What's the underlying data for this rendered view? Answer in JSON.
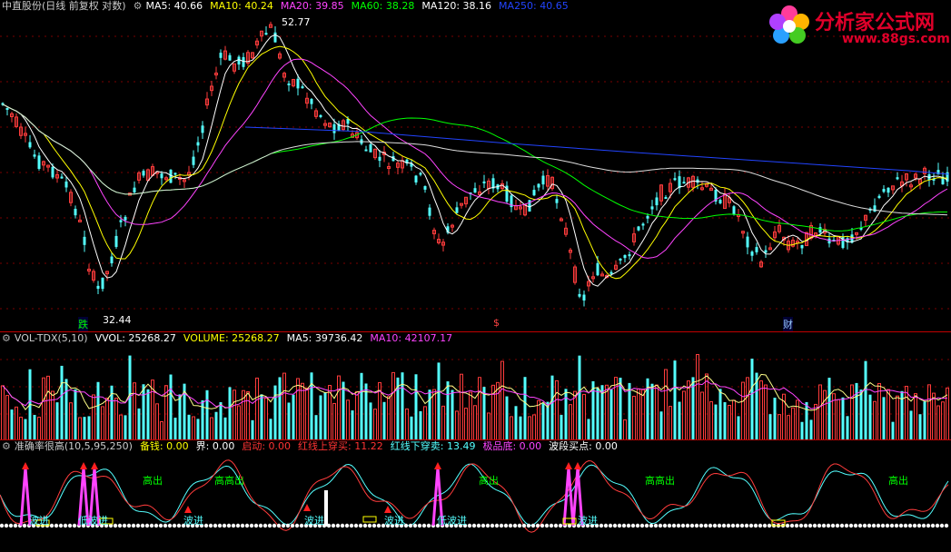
{
  "price": {
    "title": "中直股份(日线 前复权 对数)",
    "ma": [
      {
        "label": "MA5: 40.66",
        "color": "#ffffff"
      },
      {
        "label": "MA10: 40.24",
        "color": "#ffff00"
      },
      {
        "label": "MA20: 39.85",
        "color": "#ff44ff"
      },
      {
        "label": "MA60: 38.28",
        "color": "#00ff00"
      },
      {
        "label": "MA120: 38.16",
        "color": "#ffffff"
      },
      {
        "label": "MA250: 40.65",
        "color": "#2244ff"
      }
    ],
    "high_label": "52.77",
    "low_label": "32.44",
    "marker_1": "跌",
    "marker_2": "$",
    "marker_3": "财",
    "colors": {
      "up": "#ff3c3c",
      "down": "#54ffff",
      "ma5": "#ffffff",
      "ma10": "#ffff00",
      "ma20": "#ff44ff",
      "ma60": "#00ff00",
      "ma120": "#ffffff",
      "ma250": "#2244ff"
    }
  },
  "volume": {
    "title": "VOL-TDX(5,10)",
    "items": [
      {
        "label": "VVOL: 25268.27",
        "color": "#ffffff"
      },
      {
        "label": "VOLUME: 25268.27",
        "color": "#ffff00"
      },
      {
        "label": "MA5: 39736.42",
        "color": "#ffffff"
      },
      {
        "label": "MA10: 42107.17",
        "color": "#ff44ff"
      }
    ]
  },
  "indicator": {
    "title": "准确率很高(10,5,95,250)",
    "items": [
      {
        "label": "备钱: 0.00",
        "color": "#ffff00"
      },
      {
        "label": "界: 0.00",
        "color": "#ffffff"
      },
      {
        "label": "启动: 0.00",
        "color": "#ff3c3c"
      },
      {
        "label": "红线上穿买: 11.22",
        "color": "#ff3c3c"
      },
      {
        "label": "红线下穿卖: 13.49",
        "color": "#54ffff"
      },
      {
        "label": "极品底: 0.00",
        "color": "#ff44ff"
      },
      {
        "label": "波段买点: 0.00",
        "color": "#ffffff"
      }
    ],
    "sell_label": "高出",
    "sell_label_2": "高高出",
    "buy_label": "波进",
    "buy_label_2": "低波进"
  },
  "logo": {
    "text": "分析家公式网",
    "url": "www.88gs.com"
  }
}
